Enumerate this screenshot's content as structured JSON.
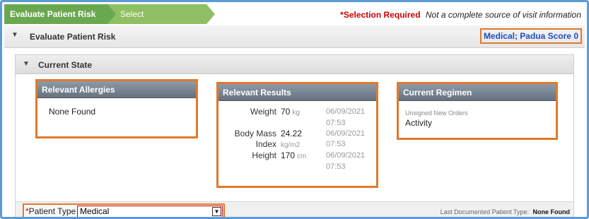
{
  "wizard": {
    "steps": [
      "Evaluate Patient Risk",
      "Select Recommendations"
    ]
  },
  "header_note": {
    "required": "*Selection Required",
    "disclaimer": "Not a complete source of visit information"
  },
  "section": {
    "title": "Evaluate Patient Risk",
    "risk_summary": "Medical; Padua Score 0"
  },
  "current_state": {
    "title": "Current State",
    "allergies": {
      "title": "Relevant Allergies",
      "value": "None Found"
    },
    "results": {
      "title": "Relevant Results",
      "rows": [
        {
          "label": "Weight",
          "value": "70",
          "unit": "kg",
          "date": "06/09/2021",
          "time": "07:53"
        },
        {
          "label": "Body Mass",
          "label2": "Index",
          "value": "24.22",
          "unit": "kg/m2",
          "date": "06/09/2021",
          "time": "07:53"
        },
        {
          "label": "Height",
          "value": "170",
          "unit": "cm",
          "date": "06/09/2021",
          "time": "07:53"
        }
      ]
    },
    "regimen": {
      "title": "Current Regimen",
      "sub": "Unsigned New Orders",
      "item": "Activity"
    }
  },
  "patient_type": {
    "star": "*",
    "label": "Patient Type",
    "value": "Medical",
    "last_documented_label": "Last Documented Patient Type:",
    "last_documented_value": "None Found"
  },
  "colors": {
    "wizard_active": "#6aa84f",
    "highlight": "#e07a2c",
    "required": "#cc0000",
    "score_text": "#1f4fc0"
  }
}
